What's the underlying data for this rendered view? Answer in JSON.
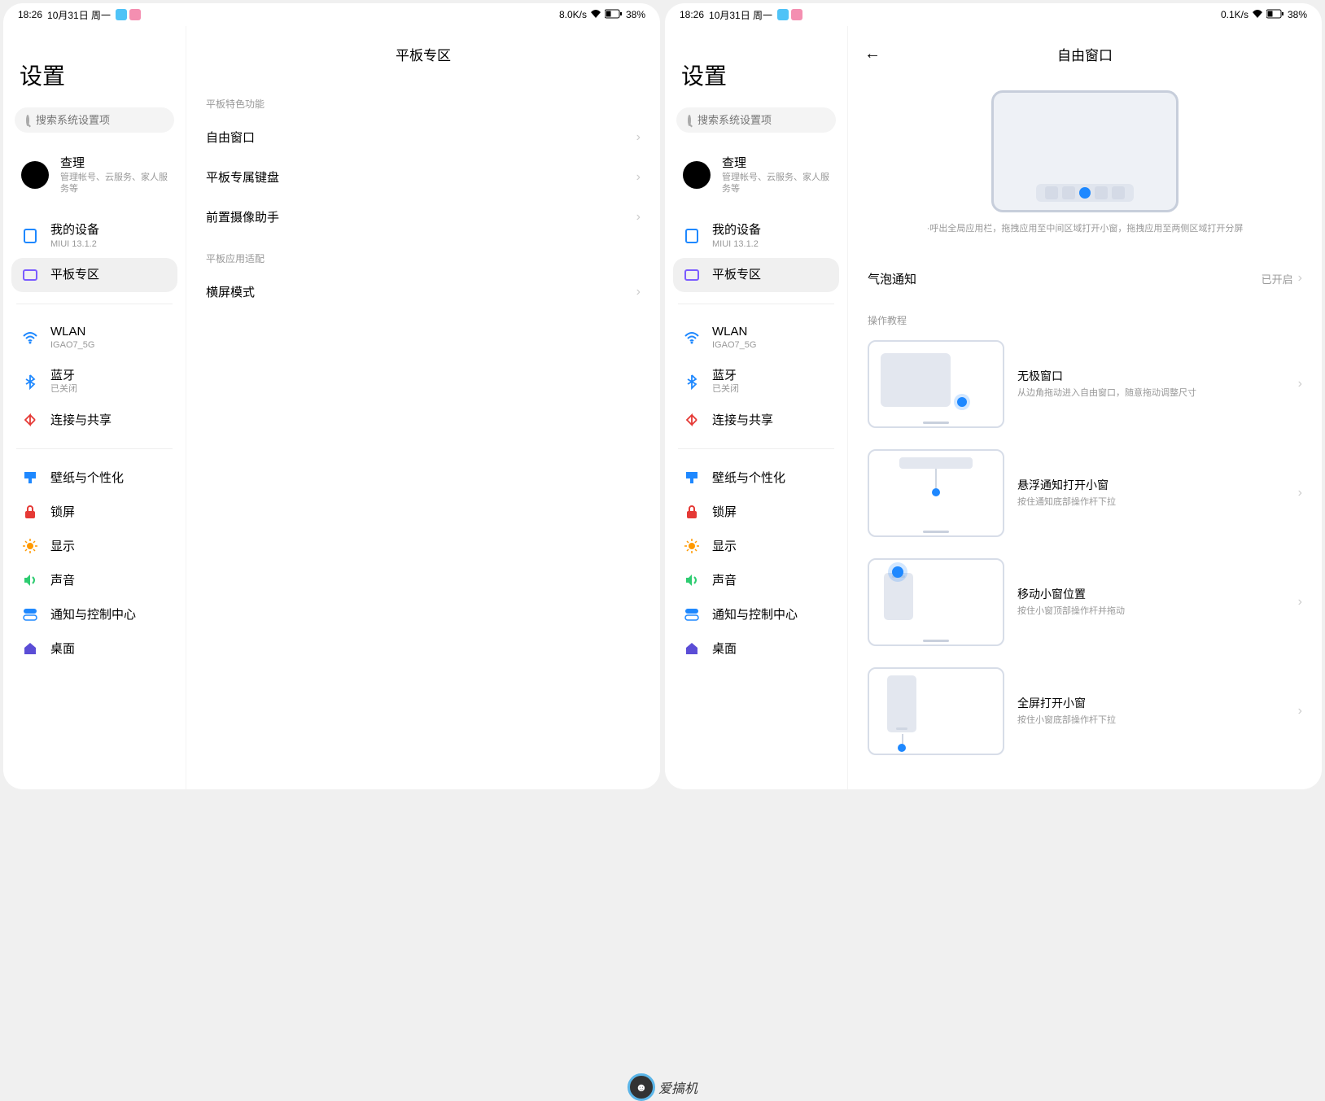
{
  "status": {
    "time": "18:26",
    "date": "10月31日 周一",
    "net1": "8.0K/s",
    "net2": "0.1K/s",
    "battery": "38%"
  },
  "sidebar": {
    "title": "设置",
    "search_placeholder": "搜索系统设置项",
    "account": {
      "name": "查理",
      "sub": "管理帐号、云服务、家人服务等"
    },
    "device": {
      "label": "我的设备",
      "sub": "MIUI 13.1.2"
    },
    "tablet": {
      "label": "平板专区"
    },
    "wlan": {
      "label": "WLAN",
      "sub": "IGAO7_5G"
    },
    "bt": {
      "label": "蓝牙",
      "sub": "已关闭"
    },
    "conn": {
      "label": "连接与共享"
    },
    "wall": {
      "label": "壁纸与个性化"
    },
    "lock": {
      "label": "锁屏"
    },
    "disp": {
      "label": "显示"
    },
    "sound": {
      "label": "声音"
    },
    "notif": {
      "label": "通知与控制中心"
    },
    "home": {
      "label": "桌面"
    }
  },
  "screen1": {
    "title": "平板专区",
    "section1": "平板特色功能",
    "row1": "自由窗口",
    "row2": "平板专属键盘",
    "row3": "前置摄像助手",
    "section2": "平板应用适配",
    "row4": "横屏模式"
  },
  "screen2": {
    "title": "自由窗口",
    "caption": "·呼出全局应用栏，拖拽应用至中间区域打开小窗，拖拽应用至两侧区域打开分屏",
    "bubble_label": "气泡通知",
    "bubble_value": "已开启",
    "section": "操作教程",
    "tut1": {
      "title": "无极窗口",
      "sub": "从边角拖动进入自由窗口，随意拖动调整尺寸"
    },
    "tut2": {
      "title": "悬浮通知打开小窗",
      "sub": "按住通知底部操作杆下拉"
    },
    "tut3": {
      "title": "移动小窗位置",
      "sub": "按住小窗顶部操作杆并拖动"
    },
    "tut4": {
      "title": "全屏打开小窗",
      "sub": "按住小窗底部操作杆下拉"
    }
  },
  "watermark": "爱搞机"
}
